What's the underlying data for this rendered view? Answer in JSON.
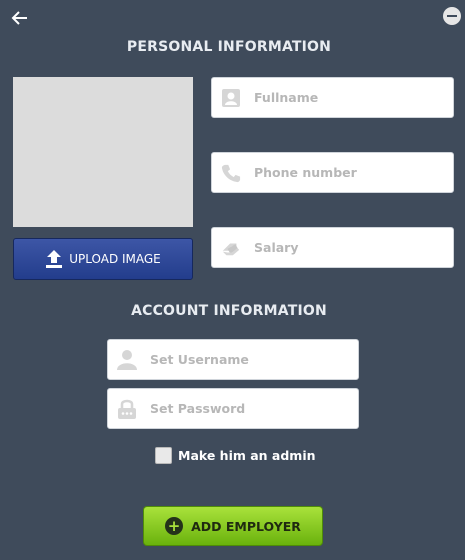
{
  "personal": {
    "title": "PERSONAL INFORMATION",
    "upload_label": "UPLOAD IMAGE",
    "fullname_placeholder": "Fullname",
    "phone_placeholder": "Phone number",
    "salary_placeholder": "Salary"
  },
  "account": {
    "title": "ACCOUNT INFORMATION",
    "username_placeholder": "Set Username",
    "password_placeholder": "Set Password",
    "admin_label": "Make him an admin"
  },
  "actions": {
    "add_label": "ADD EMPLOYER"
  },
  "icons": [
    "back-arrow-icon",
    "minimize-icon",
    "upload-icon",
    "person-icon",
    "phone-icon",
    "money-icon",
    "user-icon",
    "lock-icon",
    "plus-icon"
  ],
  "colors": {
    "background": "#3f4b5b",
    "upload_button": "#2c4597",
    "add_button": "#8fcc22"
  }
}
